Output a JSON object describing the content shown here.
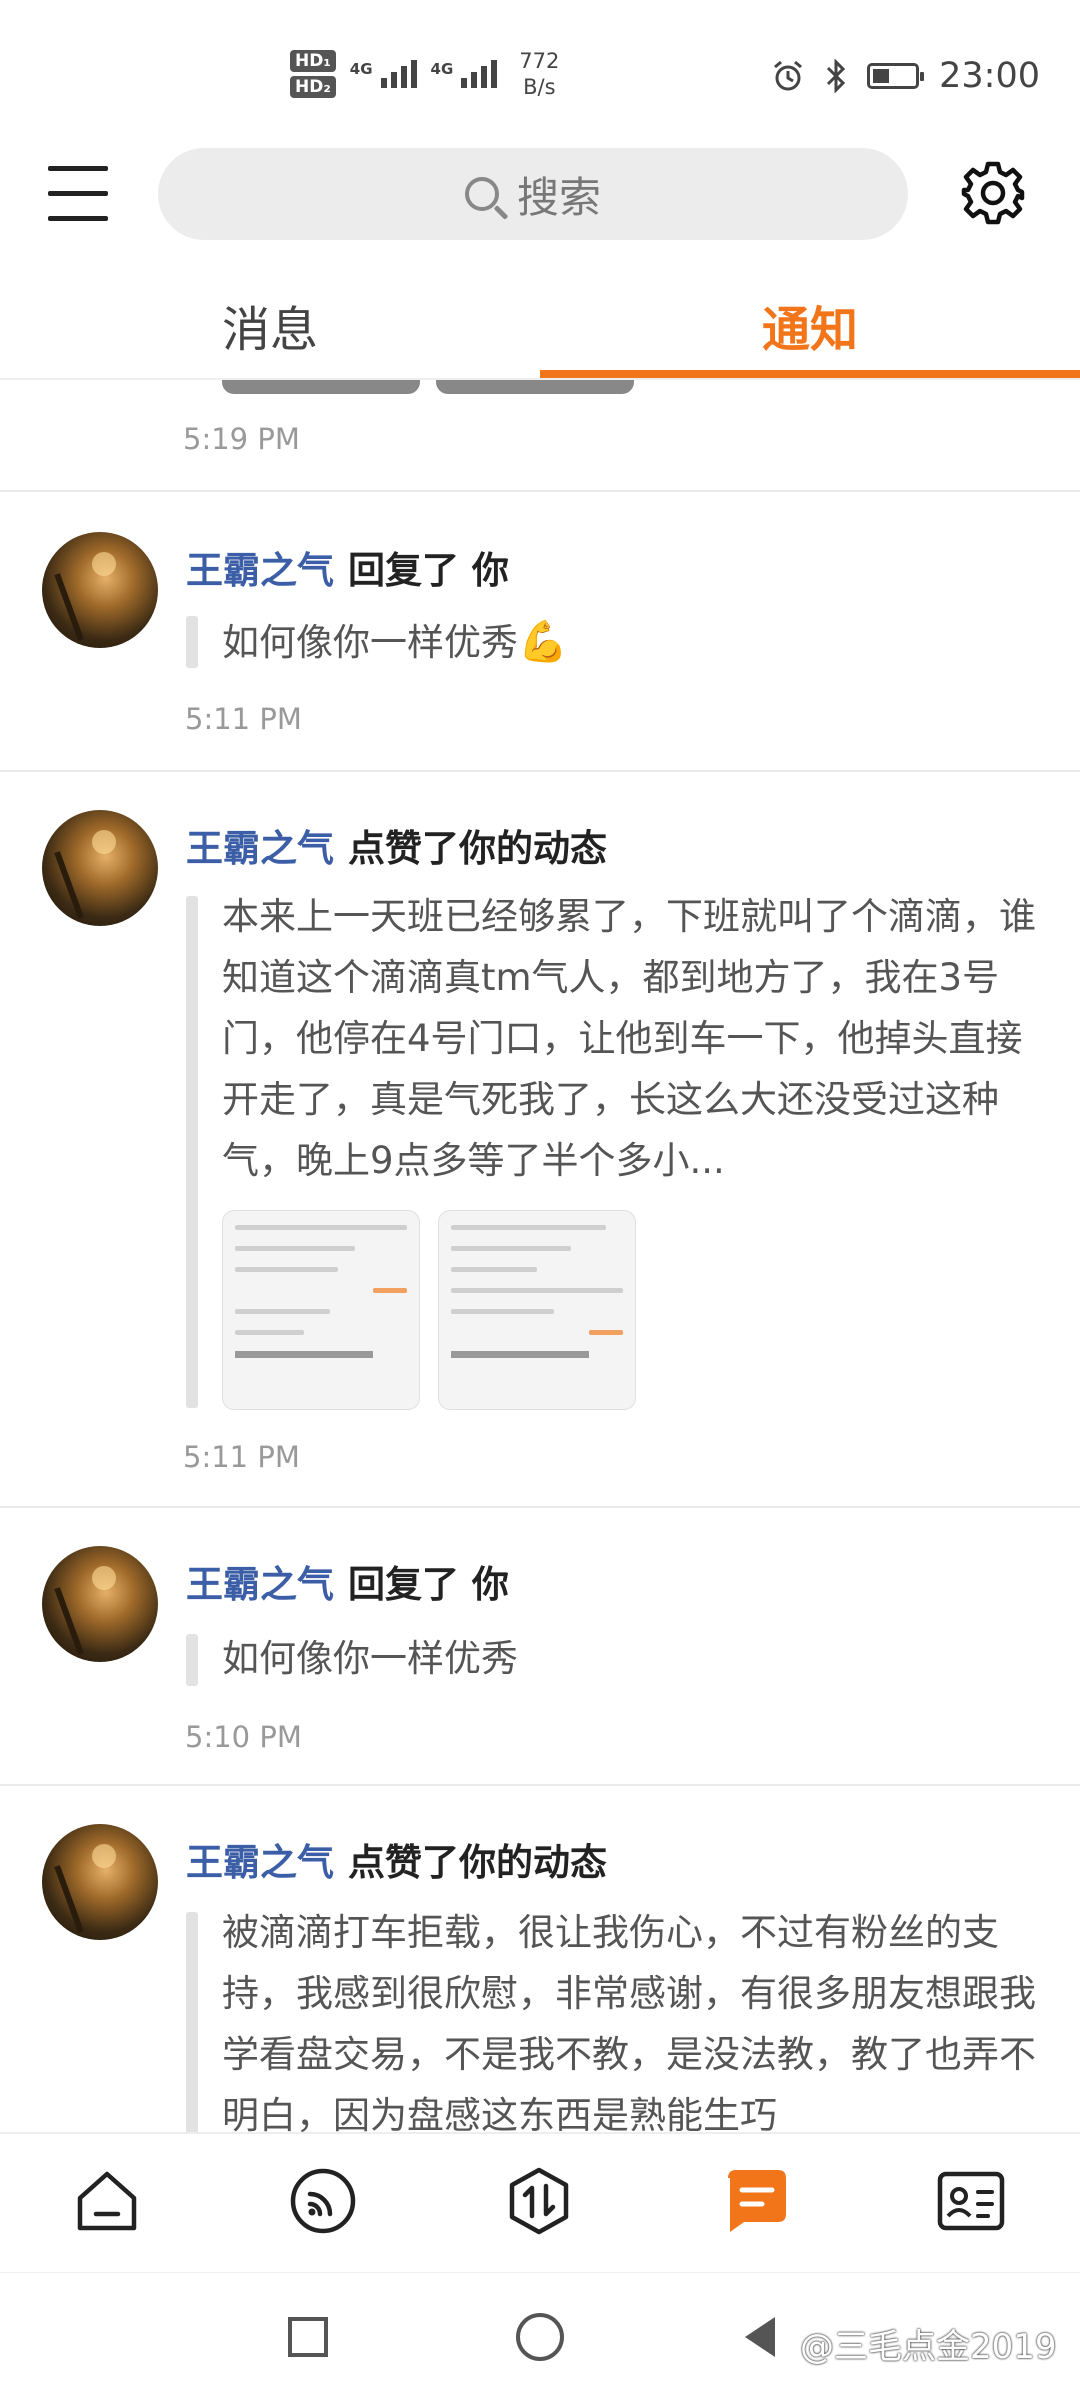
{
  "status_bar": {
    "hd1": "HD₁",
    "hd2": "HD₂",
    "sim1_label": "4G",
    "sim2_label": "4G",
    "net_speed_value": "772",
    "net_speed_unit": "B/s",
    "time": "23:00",
    "icons": [
      "alarm-icon",
      "bluetooth-icon",
      "battery-icon"
    ]
  },
  "header": {
    "search_placeholder": "搜索",
    "icons": [
      "menu-icon",
      "search-icon",
      "gear-icon"
    ]
  },
  "tabs": [
    {
      "label": "消息",
      "active": false
    },
    {
      "label": "通知",
      "active": true
    }
  ],
  "accent_color": "#f2751a",
  "username_color": "#3b5ea6",
  "feed": {
    "first_time": "5:19 PM",
    "items": [
      {
        "user": "王霸之气",
        "action": "回复了 你",
        "content": "如何像你一样优秀",
        "emoji": "💪",
        "time": "5:11 PM"
      },
      {
        "user": "王霸之气",
        "action": "点赞了你的动态",
        "content": "本来上一天班已经够累了，下班就叫了个滴滴，谁知道这个滴滴真tm气人，都到地方了，我在3号门，他停在4号门口，让他到车一下，他掉头直接开走了，真是气死我了，长这么大还没受过这种气，晚上9点多等了半个多小...",
        "time": "5:11 PM"
      },
      {
        "user": "王霸之气",
        "action": "回复了 你",
        "content": "如何像你一样优秀",
        "time": "5:10 PM"
      },
      {
        "user": "王霸之气",
        "action": "点赞了你的动态",
        "content": "被滴滴打车拒载，很让我伤心，不过有粉丝的支持，我感到很欣慰，非常感谢，有很多朋友想跟我学看盘交易，不是我不教，是没法教，教了也弄不明白，因为盘感这东西是熟能生巧"
      }
    ]
  },
  "bottom_nav": {
    "icons": [
      "home-icon",
      "feed-icon",
      "trade-icon",
      "message-icon",
      "profile-card-icon"
    ],
    "active_index": 3
  },
  "system_nav": {
    "icons": [
      "recent-apps-icon",
      "home-circle-icon",
      "back-icon"
    ],
    "watermark": "@三毛点金2019"
  }
}
